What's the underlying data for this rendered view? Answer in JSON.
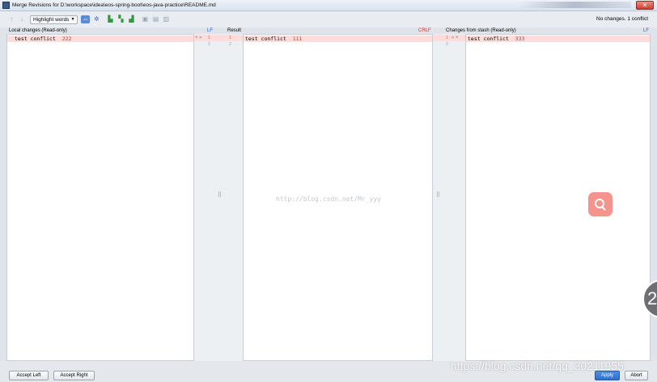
{
  "window": {
    "title": "Merge Revisions for D:\\workspace\\idea\\eos-spring-boot\\eos-java-practice\\README.md",
    "close_glyph": "✕"
  },
  "toolbar": {
    "highlight_dropdown": "Highlight words",
    "status": "No changes. 1 conflict",
    "icons": [
      "arrow-up-icon",
      "arrow-down-icon",
      "compare-icon",
      "settings-icon",
      "apply-left-icon",
      "apply-all-icon",
      "apply-right-icon",
      "magic-resolve-icon",
      "sync-icon",
      "lock-icon"
    ]
  },
  "left": {
    "header": "Local changes (Read-only)",
    "separator": "LF",
    "lines": [
      {
        "pre": "test conflict  ",
        "value": "222"
      },
      {
        "pre": "",
        "value": ""
      }
    ]
  },
  "center": {
    "header": "Result",
    "separator": "CRLF",
    "lines": [
      {
        "pre": "test conflict  ",
        "value": "111"
      },
      {
        "pre": "",
        "value": ""
      }
    ],
    "line_numbers_left": [
      "1",
      "2"
    ],
    "line_numbers_right": [
      "1",
      "2"
    ]
  },
  "right": {
    "header": "Changes from stash (Read-only)",
    "separator": "LF",
    "lines": [
      {
        "pre": "test conflict  ",
        "value": "333"
      },
      {
        "pre": "",
        "value": ""
      }
    ],
    "line_numbers": [
      "1",
      "2"
    ]
  },
  "gutter_marks": {
    "left": "× »",
    "right": "« ×"
  },
  "watermark": "http://blog.csdn.net/Mr_yyy",
  "csdn_watermark": "https://blog.csdn.net/qq_30211955",
  "badge_digit": "2",
  "buttons": {
    "accept_left": "Accept Left",
    "accept_right": "Accept Right",
    "apply": "Apply",
    "abort": "Abort"
  },
  "colors": {
    "conflict_bg": "#ffdcdc",
    "separator_blue": "#2a5fd6",
    "separator_red": "#d23a2a",
    "apply_blue": "#2c6fd1",
    "search_fab": "#f4948c"
  }
}
